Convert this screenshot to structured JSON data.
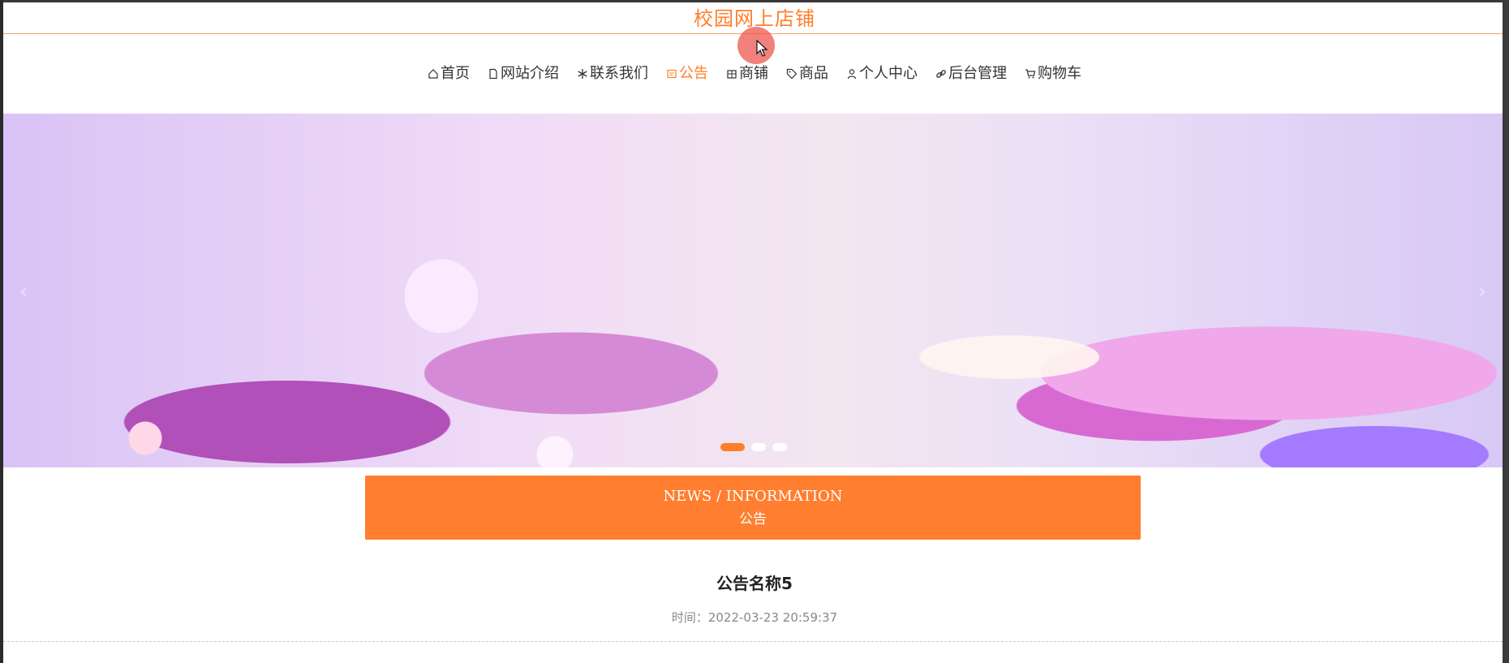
{
  "site": {
    "title": "校园网上店铺"
  },
  "nav": {
    "items": [
      {
        "label": "首页",
        "icon": "home-icon",
        "active": false
      },
      {
        "label": "网站介绍",
        "icon": "document-icon",
        "active": false
      },
      {
        "label": "联系我们",
        "icon": "snowflake-icon",
        "active": false
      },
      {
        "label": "公告",
        "icon": "notice-icon",
        "active": true
      },
      {
        "label": "商铺",
        "icon": "shop-icon",
        "active": false
      },
      {
        "label": "商品",
        "icon": "tag-icon",
        "active": false
      },
      {
        "label": "个人中心",
        "icon": "user-icon",
        "active": false
      },
      {
        "label": "后台管理",
        "icon": "link-icon",
        "active": false
      },
      {
        "label": "购物车",
        "icon": "cart-icon",
        "active": false
      }
    ]
  },
  "banner": {
    "prev_glyph": "‹",
    "next_glyph": "›",
    "slide_count": 3,
    "active_slide": 1
  },
  "section": {
    "title_en": "NEWS / INFORMATION",
    "title_cn": "公告"
  },
  "article": {
    "title": "公告名称5",
    "time_label": "时间：",
    "time_value": "2022-03-23 20:59:37"
  },
  "colors": {
    "accent": "#ff7e29",
    "header_bar": "#ff7e2f",
    "text": "#333333"
  }
}
